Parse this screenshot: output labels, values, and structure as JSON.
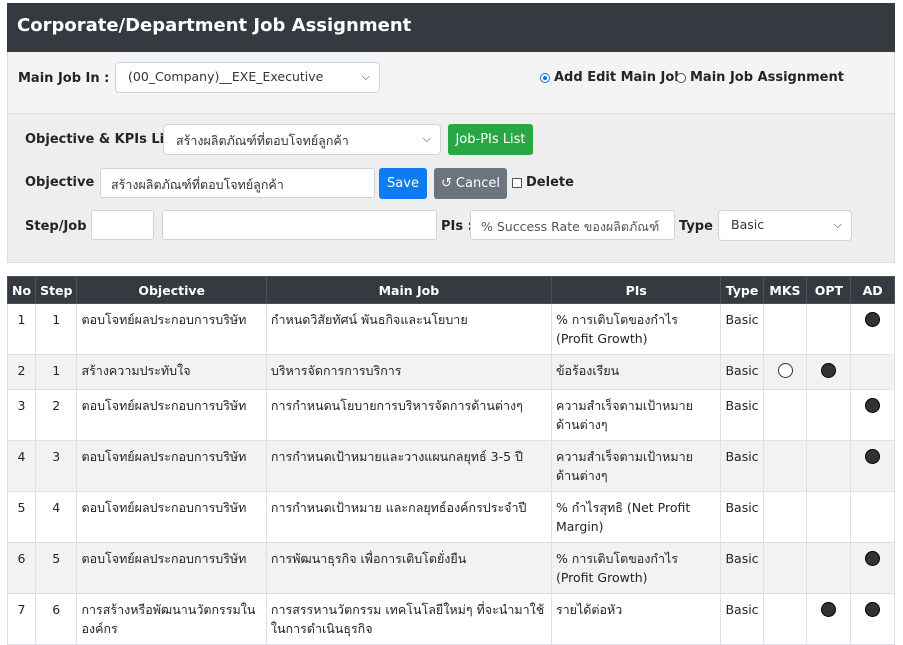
{
  "title": "Corporate/Department Job Assignment",
  "mainjob": {
    "label": "Main Job In :",
    "selected": "(00_Company)__EXE_Executive",
    "radio_add": "Add Edit Main Job",
    "radio_assign": "Main Job Assignment"
  },
  "form": {
    "kpi_label": "Objective & KPIs List :",
    "kpi_selected": "สร้างผลิตภัณฑ์ที่ตอบโจทย์ลูกค้า",
    "jobpis_button": "Job-PIs List",
    "objective_label": "Objective :",
    "objective_value": "สร้างผลิตภัณฑ์ที่ตอบโจทย์ลูกค้า",
    "save_button": "Save",
    "cancel_button": "Cancel",
    "delete_label": "Delete",
    "step_label": "Step/Job :",
    "step_value": "",
    "job_value": "",
    "pis_label": "PIs :",
    "pis_value": "% Success Rate ของผลิตภัณฑ์",
    "type_label": "Type :",
    "type_selected": "Basic"
  },
  "table": {
    "headers": [
      "No",
      "Step",
      "Objective",
      "Main Job",
      "PIs",
      "Type",
      "MKS",
      "OPT",
      "AD"
    ],
    "rows": [
      {
        "no": "1",
        "step": "1",
        "objective": "ตอบโจทย์ผลประกอบการบริษัท",
        "job": "กำหนดวิสัยทัศน์ พันธกิจและนโยบาย",
        "pis": "% การเติบโตของกำไร (Profit Growth)",
        "type": "Basic",
        "mks": "",
        "opt": "",
        "ad": "filled"
      },
      {
        "no": "2",
        "step": "1",
        "objective": "สร้างความประทับใจ",
        "job": "บริหารจัดการการบริการ",
        "pis": "ข้อร้องเรียน",
        "type": "Basic",
        "mks": "open",
        "opt": "filled",
        "ad": ""
      },
      {
        "no": "3",
        "step": "2",
        "objective": "ตอบโจทย์ผลประกอบการบริษัท",
        "job": "การกำหนดนโยบายการบริหารจัดการด้านต่างๆ",
        "pis": "ความสำเร็จตามเป้าหมายด้านต่างๆ",
        "type": "Basic",
        "mks": "",
        "opt": "",
        "ad": "filled"
      },
      {
        "no": "4",
        "step": "3",
        "objective": "ตอบโจทย์ผลประกอบการบริษัท",
        "job": "การกำหนดเป้าหมายและวางแผนกลยุทธ์ 3-5 ปี",
        "pis": "ความสำเร็จตามเป้าหมายด้านต่างๆ",
        "type": "Basic",
        "mks": "",
        "opt": "",
        "ad": "filled"
      },
      {
        "no": "5",
        "step": "4",
        "objective": "ตอบโจทย์ผลประกอบการบริษัท",
        "job": "การกำหนดเป้าหมาย และกลยุทธ์องค์กรประจำปี",
        "pis": "% กำไรสุทธิ (Net Profit Margin)",
        "type": "Basic",
        "mks": "",
        "opt": "",
        "ad": ""
      },
      {
        "no": "6",
        "step": "5",
        "objective": "ตอบโจทย์ผลประกอบการบริษัท",
        "job": "การพัฒนาธุรกิจ เพื่อการเติบโตยั่งยืน",
        "pis": "% การเติบโตของกำไร (Profit Growth)",
        "type": "Basic",
        "mks": "",
        "opt": "",
        "ad": "filled"
      },
      {
        "no": "7",
        "step": "6",
        "objective": "การสร้างหรือพัฒนานวัตกรรมในองค์กร",
        "job": "การสรรหานวัตกรรม เทคโนโลยีใหม่ๆ ที่จะนำมาใช้ในการดำเนินธุรกิจ",
        "pis": "รายได้ต่อหัว",
        "type": "Basic",
        "mks": "",
        "opt": "filled",
        "ad": "filled"
      }
    ]
  }
}
